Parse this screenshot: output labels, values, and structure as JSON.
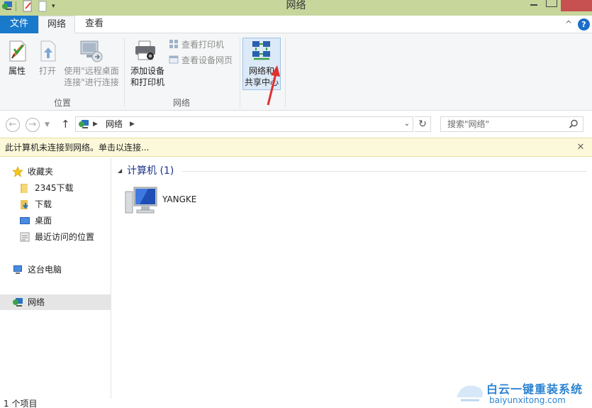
{
  "window": {
    "title": "网络"
  },
  "ribbon": {
    "tabs": [
      {
        "label": "文件"
      },
      {
        "label": "网络"
      },
      {
        "label": "查看"
      }
    ],
    "groups": {
      "location": {
        "label": "位置",
        "properties_label": "属性",
        "open_label": "打开",
        "remote_line1": "使用\"远程桌面",
        "remote_line2": "连接\"进行连接"
      },
      "network": {
        "label": "网络",
        "add_line1": "添加设备",
        "add_line2": "和打印机",
        "view_printers": "查看打印机",
        "view_device_page": "查看设备网页"
      },
      "sharing": {
        "line1": "网络和",
        "line2": "共享中心"
      }
    }
  },
  "address": {
    "location": "网络",
    "search_placeholder": "搜索\"网络\""
  },
  "infobar": {
    "message": "此计算机未连接到网络。单击以连接..."
  },
  "navpane": {
    "favorites": "收藏夹",
    "fav_items": [
      "2345下载",
      "下载",
      "桌面",
      "最近访问的位置"
    ],
    "this_pc": "这台电脑",
    "network": "网络"
  },
  "content": {
    "group_header": "计算机 (1)",
    "computer_name": "YANGKE"
  },
  "status": {
    "item_count": "1 个项目"
  },
  "watermark": {
    "line1": "白云一键重装系统",
    "line2": "baiyunxitong.com"
  }
}
